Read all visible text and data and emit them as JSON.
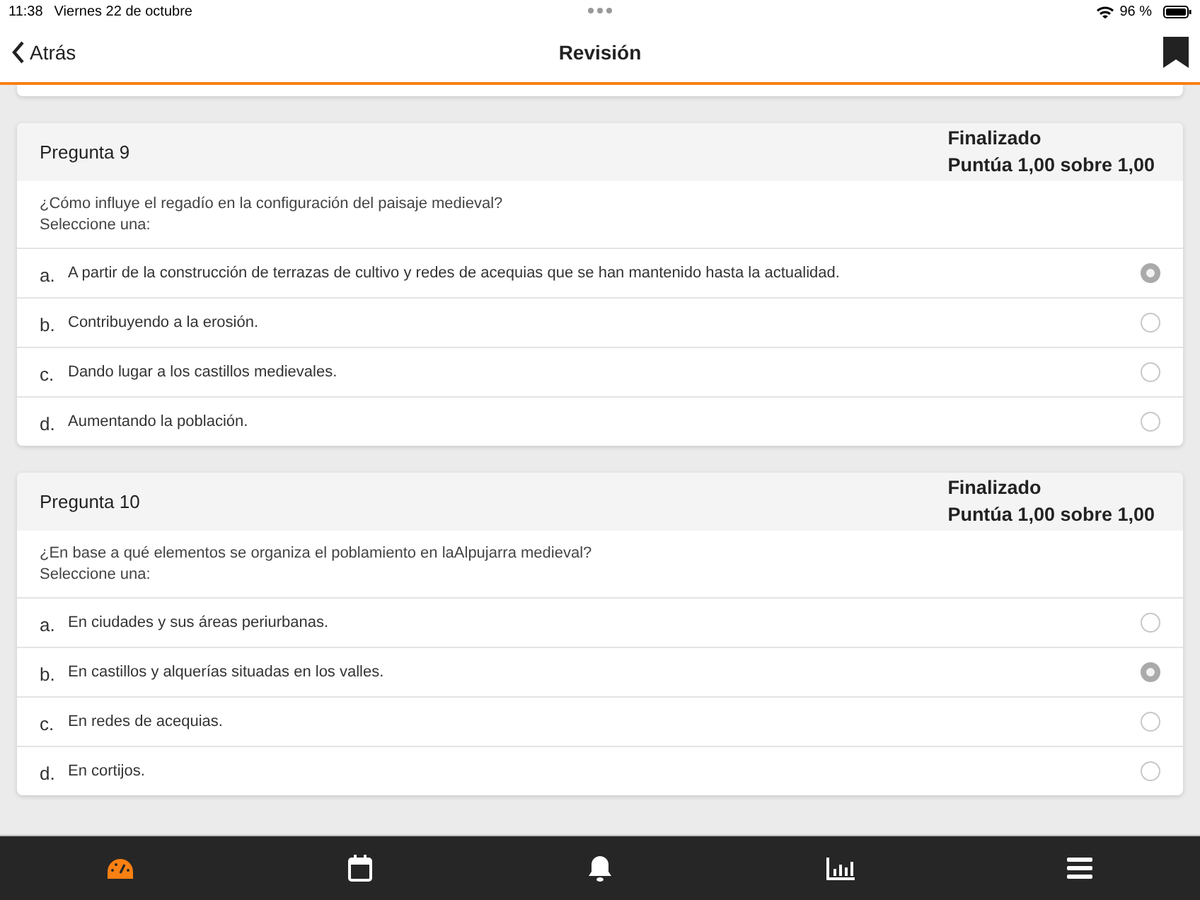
{
  "status_bar": {
    "time": "11:38",
    "date": "Viernes 22 de octubre",
    "battery": "96 %"
  },
  "nav": {
    "back": "Atrás",
    "title": "Revisión"
  },
  "questions": [
    {
      "title": "Pregunta 9",
      "state": "Finalizado",
      "grade": "Puntúa 1,00 sobre 1,00",
      "text": "¿Cómo influye el regadío en la configuración del paisaje medieval?",
      "prompt": "Seleccione una:",
      "options": [
        {
          "letter": "a.",
          "text": "A partir de la construcción de terrazas de cultivo y redes de acequias que se han mantenido hasta la actualidad.",
          "selected": true
        },
        {
          "letter": "b.",
          "text": "Contribuyendo a la erosión.",
          "selected": false
        },
        {
          "letter": "c.",
          "text": "Dando lugar a los castillos medievales.",
          "selected": false
        },
        {
          "letter": "d.",
          "text": "Aumentando la población.",
          "selected": false
        }
      ]
    },
    {
      "title": "Pregunta 10",
      "state": "Finalizado",
      "grade": "Puntúa 1,00 sobre 1,00",
      "text": "¿En base a qué elementos se organiza el poblamiento en laAlpujarra medieval?",
      "prompt": "Seleccione una:",
      "options": [
        {
          "letter": "a.",
          "text": "En ciudades y sus áreas periurbanas.",
          "selected": false
        },
        {
          "letter": "b.",
          "text": "En castillos y alquerías situadas en los valles.",
          "selected": true
        },
        {
          "letter": "c.",
          "text": "En redes de acequias.",
          "selected": false
        },
        {
          "letter": "d.",
          "text": "En cortijos.",
          "selected": false
        }
      ]
    }
  ],
  "tab_bar": [
    {
      "kind": "dashboard",
      "selected": true
    },
    {
      "kind": "calendar",
      "selected": false
    },
    {
      "kind": "notifications",
      "selected": false
    },
    {
      "kind": "grades",
      "selected": false
    },
    {
      "kind": "menu",
      "selected": false
    }
  ]
}
